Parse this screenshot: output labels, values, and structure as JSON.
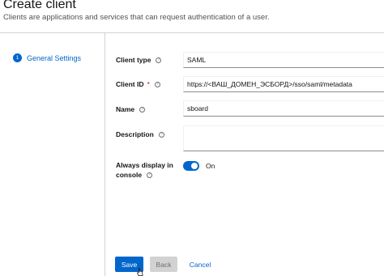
{
  "header": {
    "title": "Create client",
    "subtitle": "Clients are applications and services that can request authentication of a user."
  },
  "wizard": {
    "steps": [
      {
        "number": "1",
        "label": "General Settings"
      }
    ]
  },
  "form": {
    "client_type": {
      "label": "Client type",
      "value": "SAML"
    },
    "client_id": {
      "label": "Client ID",
      "required_mark": "*",
      "value": "https://<ВАШ_ДОМЕН_ЭСБОРД>/sso/saml/metadata"
    },
    "name": {
      "label": "Name",
      "value": "sboard"
    },
    "description": {
      "label": "Description",
      "value": ""
    },
    "always_display": {
      "label_line1": "Always display in",
      "label_line2": "console",
      "state": "On",
      "enabled": true
    }
  },
  "actions": {
    "save": "Save",
    "back": "Back",
    "cancel": "Cancel"
  },
  "icons": {
    "help": "?",
    "cursor": "hand-pointer-icon"
  },
  "colors": {
    "primary": "#0066cc",
    "disabled_bg": "#d2d2d2",
    "required": "#c9190b"
  }
}
